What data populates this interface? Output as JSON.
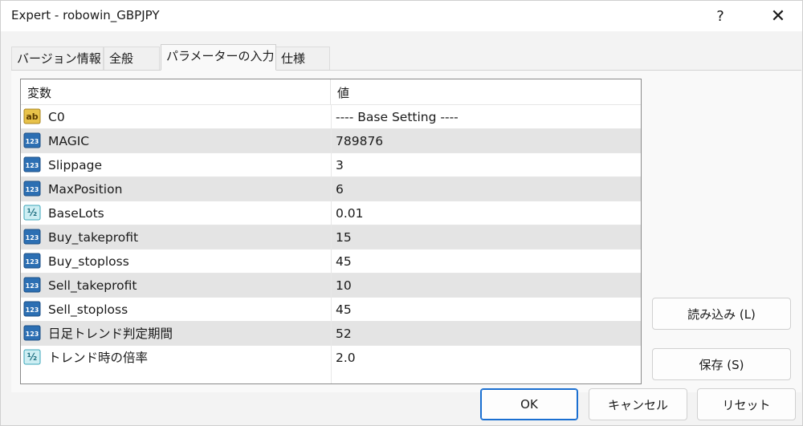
{
  "window": {
    "title": "Expert - robowin_GBPJPY",
    "help_label": "?",
    "close_label": "✕"
  },
  "tabs": [
    {
      "label": "バージョン情報",
      "active": false
    },
    {
      "label": "全般",
      "active": false
    },
    {
      "label": "パラメーターの入力",
      "active": true
    },
    {
      "label": "仕様",
      "active": false
    }
  ],
  "grid": {
    "header_variable": "変数",
    "header_value": "値",
    "rows": [
      {
        "icon": "ab-string-icon",
        "name": "C0",
        "value": "---- Base Setting ----"
      },
      {
        "icon": "123-integer-icon",
        "name": "MAGIC",
        "value": "789876"
      },
      {
        "icon": "123-integer-icon",
        "name": "Slippage",
        "value": "3"
      },
      {
        "icon": "123-integer-icon",
        "name": "MaxPosition",
        "value": "6"
      },
      {
        "icon": "half-double-icon",
        "name": "BaseLots",
        "value": "0.01"
      },
      {
        "icon": "123-integer-icon",
        "name": "Buy_takeprofit",
        "value": "15"
      },
      {
        "icon": "123-integer-icon",
        "name": "Buy_stoploss",
        "value": "45"
      },
      {
        "icon": "123-integer-icon",
        "name": "Sell_takeprofit",
        "value": "10"
      },
      {
        "icon": "123-integer-icon",
        "name": "Sell_stoploss",
        "value": "45"
      },
      {
        "icon": "123-integer-icon",
        "name": "日足トレンド判定期間",
        "value": "52"
      },
      {
        "icon": "half-double-icon",
        "name": "トレンド時の倍率",
        "value": "2.0"
      }
    ]
  },
  "buttons": {
    "load": "読み込み (L)",
    "save": "保存 (S)",
    "ok": "OK",
    "cancel": "キャンセル",
    "reset": "リセット"
  },
  "colors": {
    "row_alt": "#e4e4e4",
    "icon_int_blue": "#2c6fb3",
    "icon_string_yellow": "#e8c24a",
    "icon_double_teal": "#3aa6b9",
    "ok_border": "#1a6fd1"
  }
}
